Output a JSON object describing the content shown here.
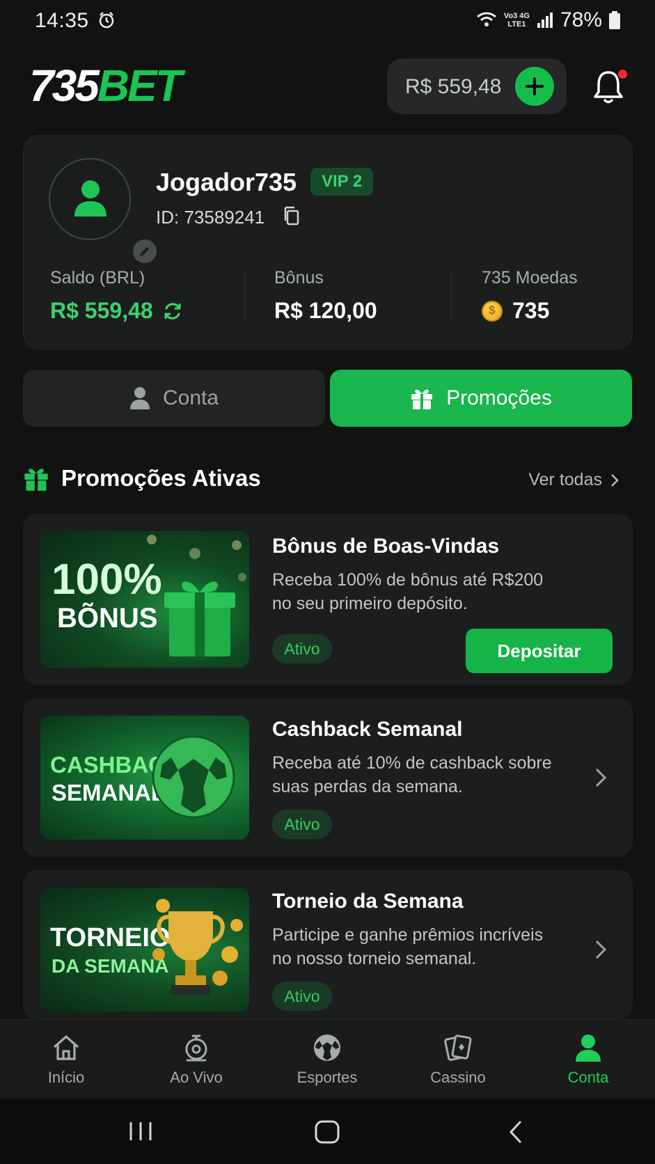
{
  "status_bar": {
    "time": "14:35",
    "network_line1": "Vo3 4G",
    "network_line2": "LTE1",
    "battery": "78%",
    "icons": [
      "alarm-icon",
      "wifi-icon",
      "signal-icon",
      "battery-icon"
    ]
  },
  "header": {
    "logo_white": "735",
    "logo_green": "BET",
    "balance": "R$ 559,48",
    "add_icon": "plus-icon",
    "notification_icon": "bell-icon",
    "has_notification": true
  },
  "profile": {
    "username": "Jogador735",
    "vip": "VIP 2",
    "user_id": "ID: 73589241",
    "stats": [
      {
        "label": "Saldo (BRL)",
        "value": "R$ 559,48",
        "color": "#3ed26f"
      },
      {
        "label": "Bônus",
        "value": "R$ 120,00",
        "color": "#ffffff"
      },
      {
        "label": "735 Moedas",
        "value": "735",
        "color": "#ffffff"
      }
    ]
  },
  "tabs": [
    {
      "label": "Conta",
      "active": false
    },
    {
      "label": "Promoções",
      "active": true
    }
  ],
  "section": {
    "title": "Promoções Ativas",
    "see_all": "Ver todas"
  },
  "promotions": [
    {
      "title": "Bônus de Boas-Vindas",
      "description": "Receba 100% de bônus até R$200 no seu primeiro depósito.",
      "status": "Ativo",
      "action": "Depositar",
      "image_line1": "100%",
      "image_line2": "BÕNUS"
    },
    {
      "title": "Cashback Semanal",
      "description": "Receba até 10% de cashback sobre suas perdas da semana.",
      "status": "Ativo",
      "image_line1": "CASHBACK",
      "image_line2": "SEMANAL"
    },
    {
      "title": "Torneio da Semana",
      "description": "Participe e ganhe prêmios incríveis no nosso torneio semanal.",
      "status": "Ativo",
      "image_line1": "TORNEIO",
      "image_line2": "DA SEMANA"
    }
  ],
  "bottom_nav": [
    {
      "label": "Início",
      "icon": "home-icon",
      "active": false
    },
    {
      "label": "Ao Vivo",
      "icon": "live-icon",
      "active": false
    },
    {
      "label": "Esportes",
      "icon": "soccer-ball-icon",
      "active": false
    },
    {
      "label": "Cassino",
      "icon": "cards-icon",
      "active": false
    },
    {
      "label": "Conta",
      "icon": "user-icon",
      "active": true
    }
  ],
  "colors": {
    "accent": "#19b74d",
    "background": "#111212",
    "card": "#1c1e1e"
  }
}
